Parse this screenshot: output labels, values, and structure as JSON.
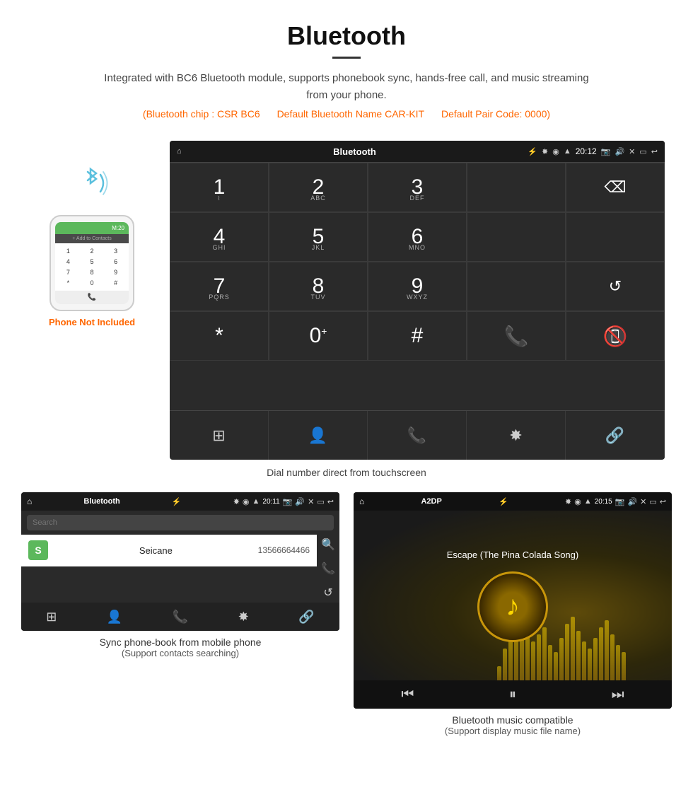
{
  "page": {
    "title": "Bluetooth",
    "description": "Integrated with BC6 Bluetooth module, supports phonebook sync, hands-free call, and music streaming from your phone.",
    "specs": [
      "(Bluetooth chip : CSR BC6",
      "Default Bluetooth Name CAR-KIT",
      "Default Pair Code: 0000)"
    ],
    "dial_caption": "Dial number direct from touchscreen",
    "phonebook_caption_main": "Sync phone-book from mobile phone",
    "phonebook_caption_sub": "(Support contacts searching)",
    "music_caption_main": "Bluetooth music compatible",
    "music_caption_sub": "(Support display music file name)"
  },
  "phone_illustration": {
    "not_included_label": "Phone Not Included",
    "call_label": "Add to Contacts",
    "keypad": [
      "1",
      "2",
      "3",
      "4",
      "5",
      "6",
      "7",
      "8",
      "9",
      "*",
      "0",
      "#"
    ]
  },
  "dial_screen": {
    "title": "Bluetooth",
    "time": "20:12",
    "keys": [
      {
        "num": "1",
        "sub": ""
      },
      {
        "num": "2",
        "sub": "ABC"
      },
      {
        "num": "3",
        "sub": "DEF"
      },
      {
        "num": "",
        "sub": ""
      },
      {
        "num": "⌫",
        "sub": ""
      },
      {
        "num": "4",
        "sub": "GHI"
      },
      {
        "num": "5",
        "sub": "JKL"
      },
      {
        "num": "6",
        "sub": "MNO"
      },
      {
        "num": "",
        "sub": ""
      },
      {
        "num": "",
        "sub": ""
      },
      {
        "num": "7",
        "sub": "PQRS"
      },
      {
        "num": "8",
        "sub": "TUV"
      },
      {
        "num": "9",
        "sub": "WXYZ"
      },
      {
        "num": "",
        "sub": ""
      },
      {
        "num": "↺",
        "sub": ""
      },
      {
        "num": "*",
        "sub": ""
      },
      {
        "num": "0+",
        "sub": ""
      },
      {
        "num": "#",
        "sub": ""
      },
      {
        "num": "📞",
        "sub": ""
      },
      {
        "num": "📵",
        "sub": ""
      }
    ],
    "bottom_icons": [
      "⊞",
      "👤",
      "📞",
      "⚡",
      "🔗"
    ]
  },
  "phonebook_screen": {
    "title": "Bluetooth",
    "time": "20:11",
    "search_placeholder": "Search",
    "contact_letter": "S",
    "contact_name": "Seicane",
    "contact_number": "13566664466"
  },
  "music_screen": {
    "title": "A2DP",
    "time": "20:15",
    "song_title": "Escape (The Pina Colada Song)",
    "eq_bars": [
      20,
      45,
      60,
      80,
      90,
      70,
      55,
      65,
      75,
      50,
      40,
      60,
      80,
      90,
      70,
      55,
      45,
      60,
      75,
      85,
      65,
      50,
      40
    ]
  },
  "colors": {
    "accent": "#ff6600",
    "android_bg": "#2a2a2a",
    "android_bar": "#1a1a1a",
    "green": "#4caf50",
    "red": "#f44336",
    "gold": "#ffd700"
  },
  "icons": {
    "home": "⌂",
    "back": "↩",
    "usb": "⚡",
    "bluetooth": "⚡",
    "search": "🔍",
    "phone": "📞",
    "refresh": "↺",
    "grid": "⊞",
    "person": "👤",
    "link": "🔗",
    "music_note": "♪",
    "prev": "⏮",
    "play": "⏸",
    "next": "⏭",
    "camera": "📷",
    "volume": "🔊"
  }
}
